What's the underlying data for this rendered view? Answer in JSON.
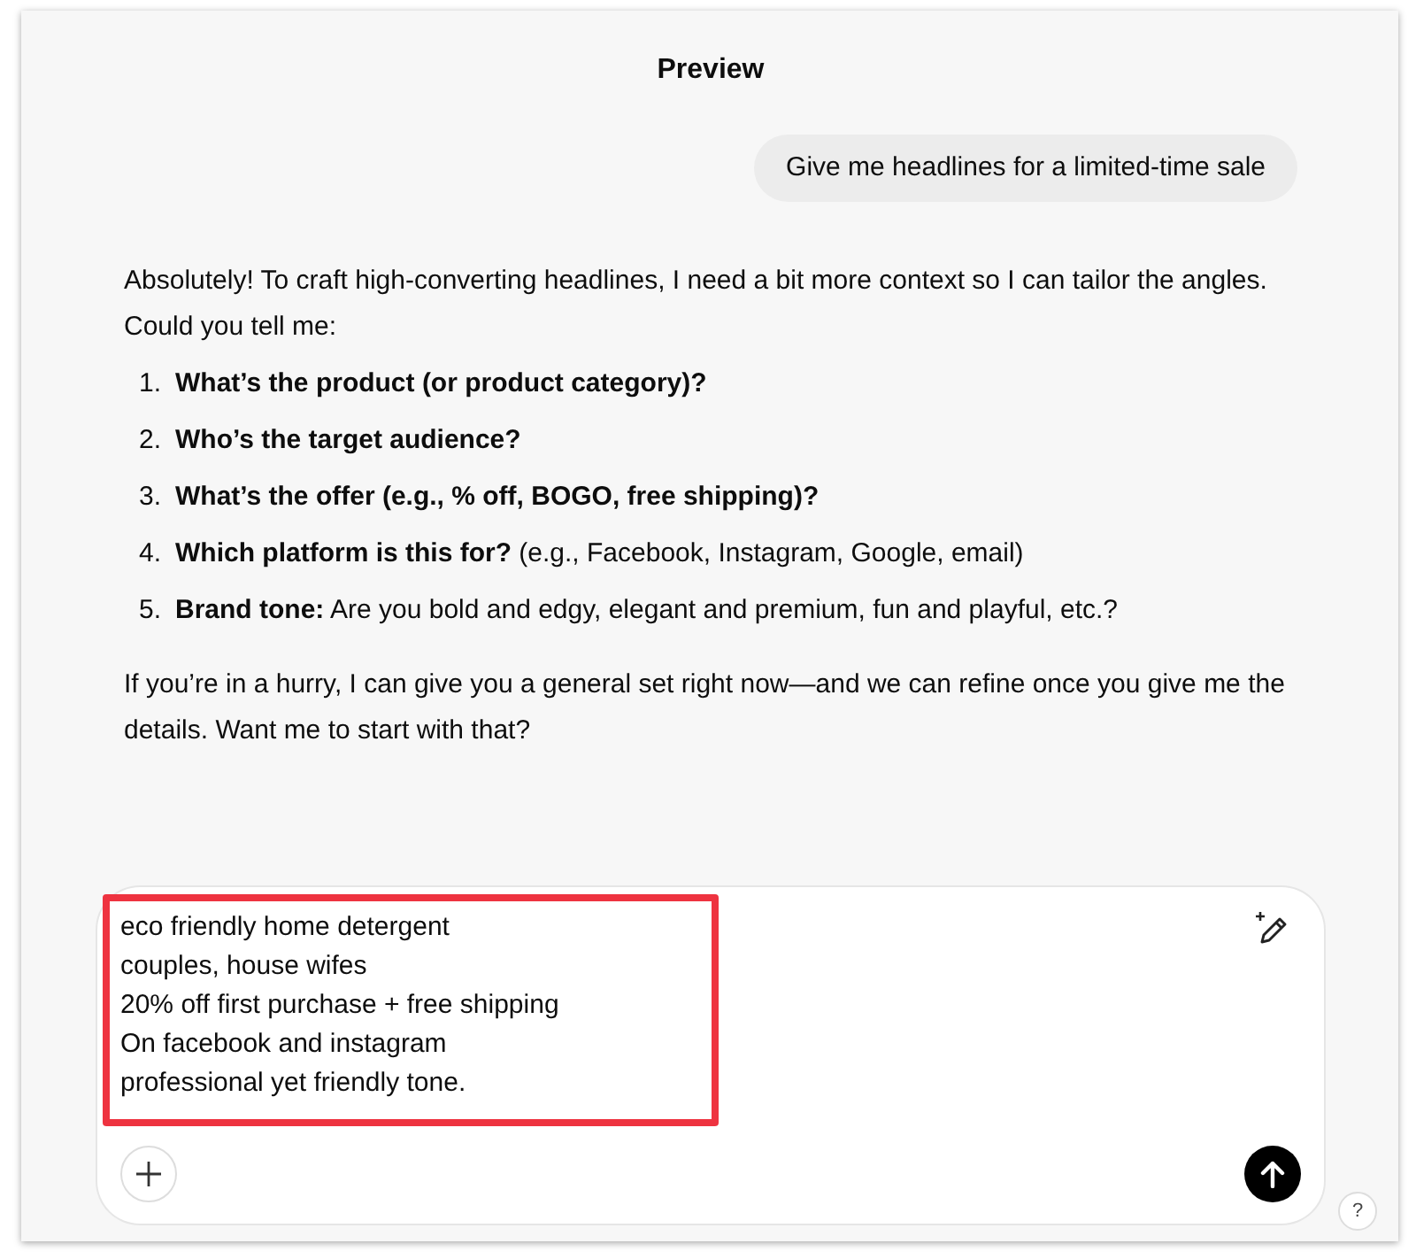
{
  "window": {
    "title": "Preview"
  },
  "user_message": {
    "text": "Give me headlines for a limited-time sale"
  },
  "assistant_message": {
    "intro": "Absolutely! To craft high-converting headlines, I need a bit more context so I can tailor the angles. Could you tell me:",
    "questions": [
      {
        "number": "1.",
        "text": "**What’s the product (or product category)?**"
      },
      {
        "number": "2.",
        "text": "**Who’s the target audience?**"
      },
      {
        "number": "3.",
        "text": "**What’s the offer (e.g., % off, BOGO, free shipping)?**"
      },
      {
        "number": "4.",
        "text": "**Which platform is this for?** (e.g., Facebook, Instagram, Google, email)"
      },
      {
        "number": "5.",
        "text": "**Brand tone:** Are you bold and edgy, elegant and premium, fun and playful, etc.?"
      }
    ],
    "outro": "If you’re in a hurry, I can give you a general set right now—and we can refine once you give me the details. Want me to start with that?"
  },
  "composer": {
    "value_lines": [
      "eco friendly home detergent",
      "couples, house wifes",
      "20% off first purchase + free shipping",
      "On facebook and instagram",
      "professional yet friendly tone."
    ],
    "highlighted": true
  },
  "help_button": {
    "label": "?"
  }
}
